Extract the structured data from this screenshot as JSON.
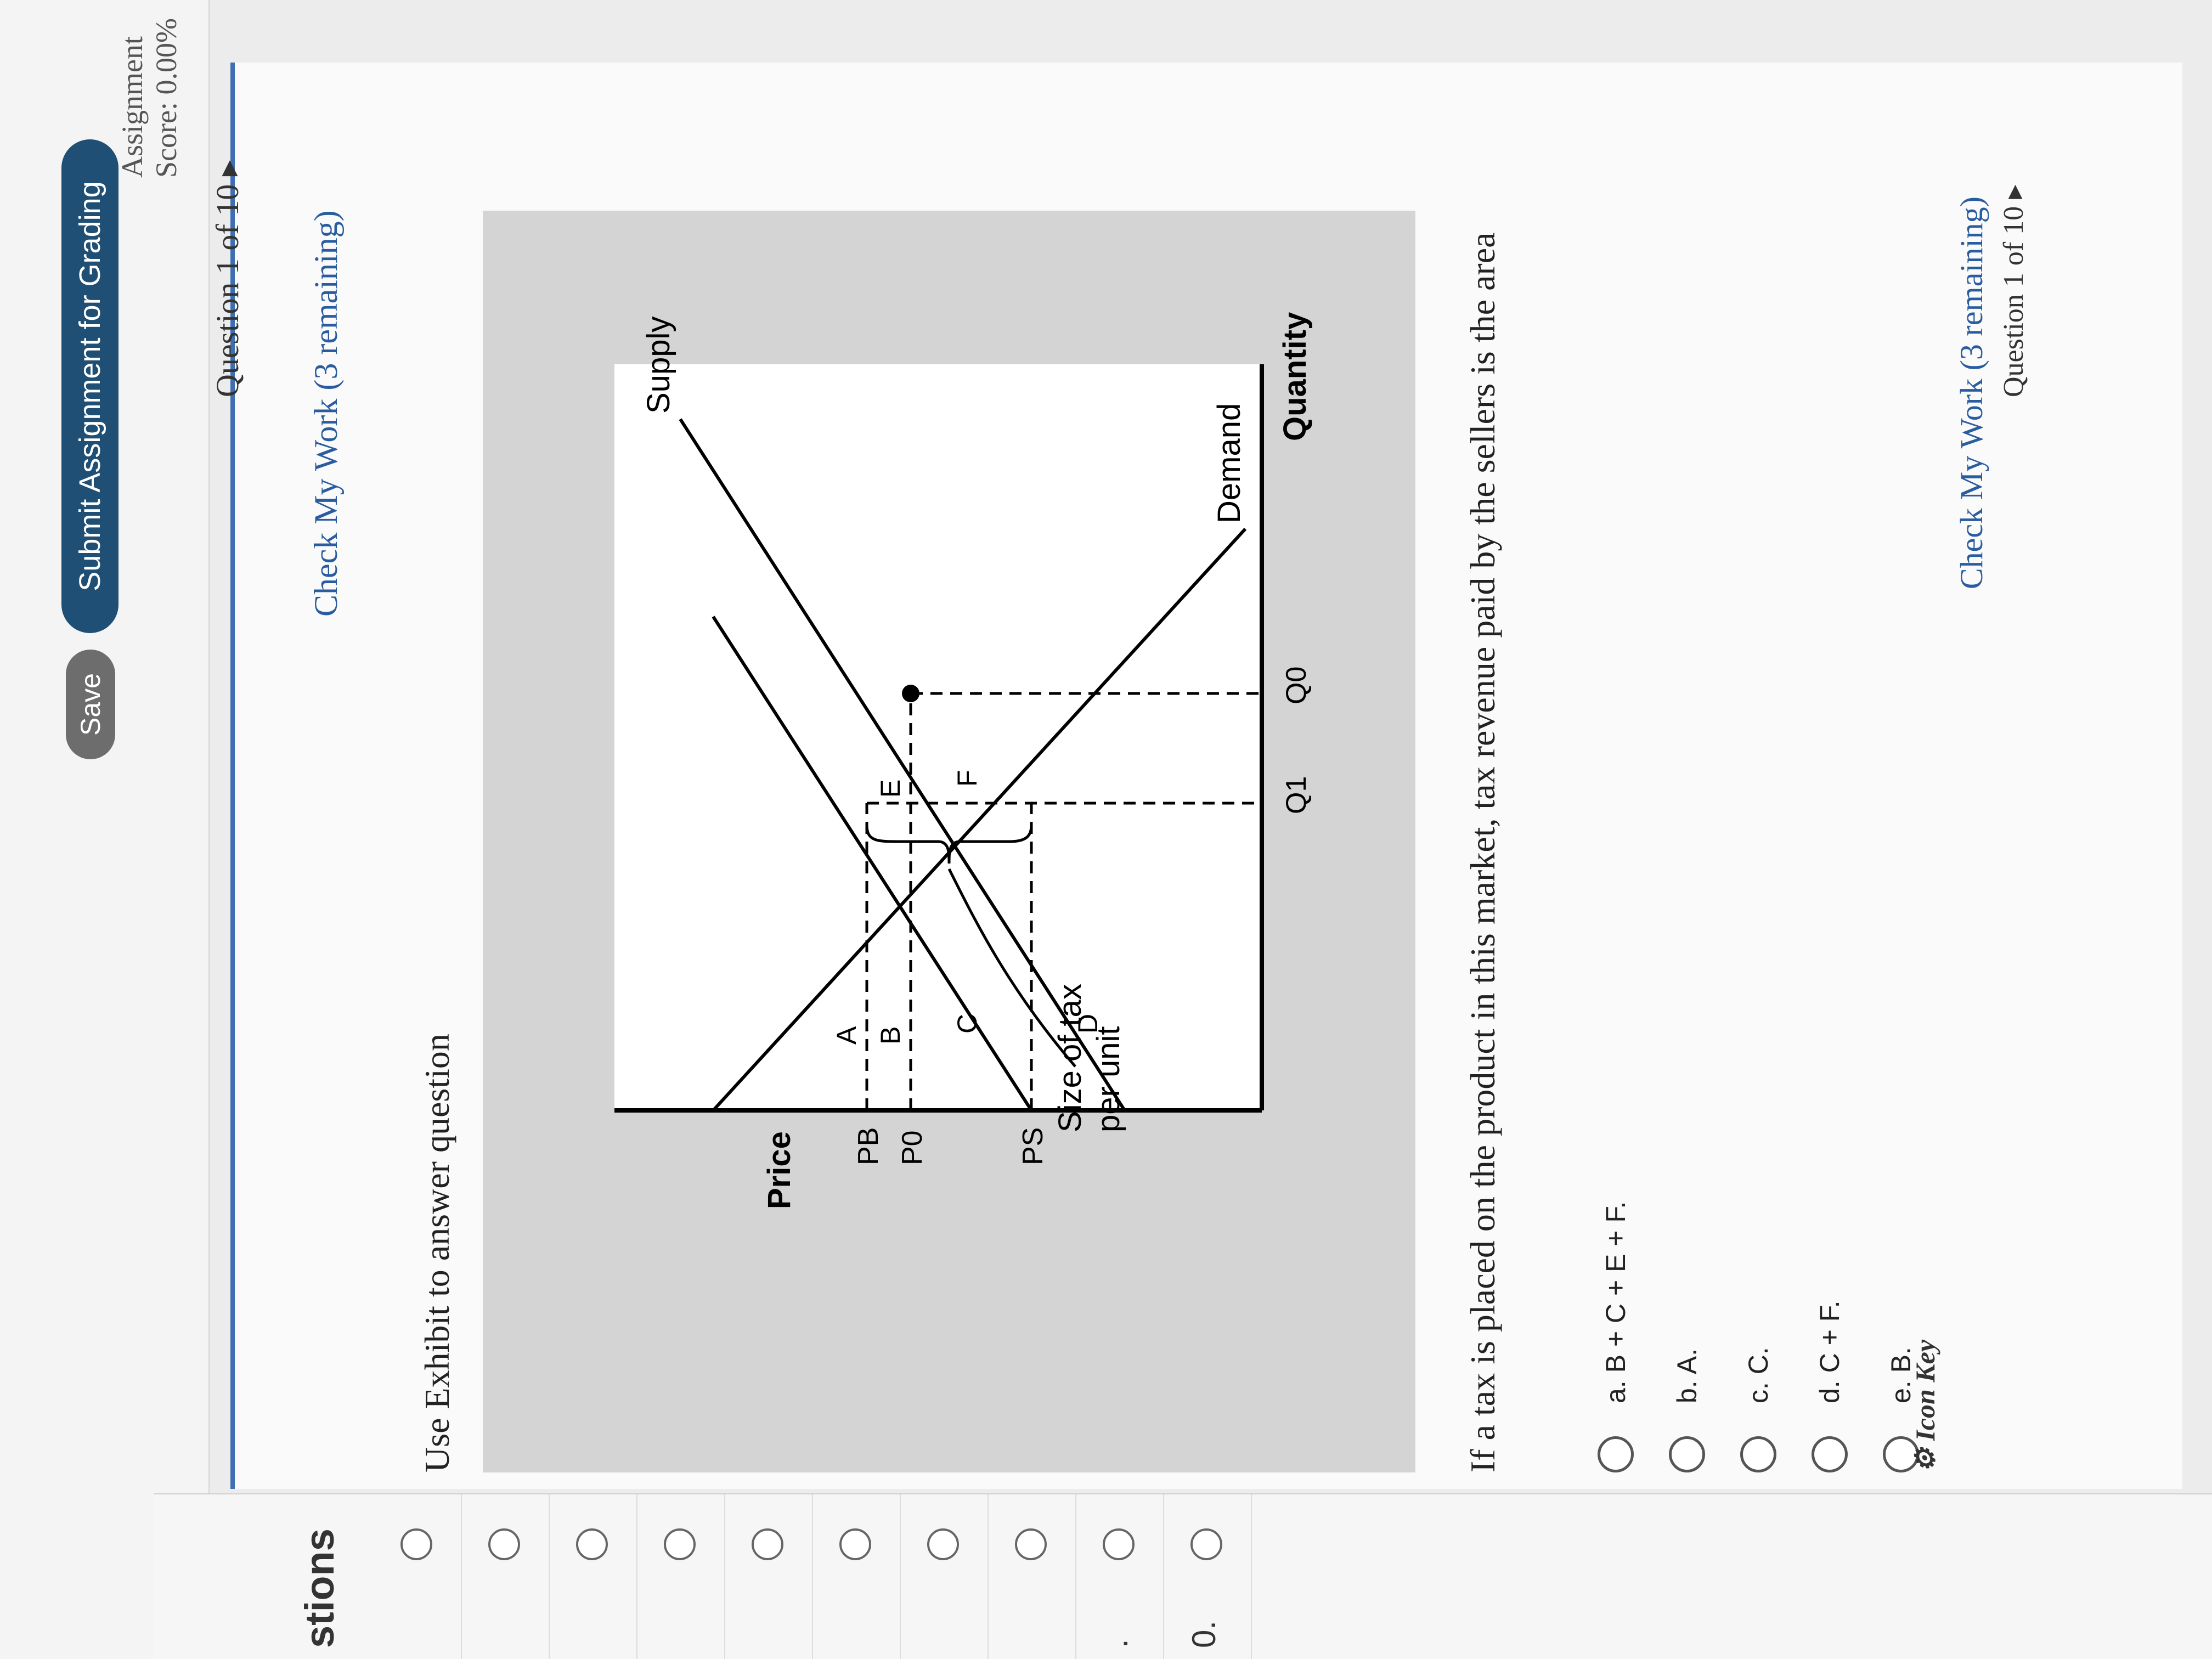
{
  "header": {
    "score_text": "Assignment Score: 0.00%",
    "save_label": "Save",
    "submit_label": "Submit Assignment for Grading"
  },
  "sidebar": {
    "title": "stions",
    "rows": [
      {
        "num": ""
      },
      {
        "num": ""
      },
      {
        "num": ""
      },
      {
        "num": ""
      },
      {
        "num": ""
      },
      {
        "num": ""
      },
      {
        "num": ""
      },
      {
        "num": ""
      },
      {
        "num": "."
      },
      {
        "num": "0."
      }
    ]
  },
  "nav": {
    "question_label": "Question 1 of 10",
    "check_label": "Check My Work (3 remaining)"
  },
  "content": {
    "instruction": "Use Exhibit to answer question",
    "question_text": "If a tax is placed on the product in this market, tax revenue paid by the sellers is the area"
  },
  "exhibit": {
    "y_axis_label": "Price",
    "x_axis_label": "Quantity",
    "supply_label": "Supply",
    "demand_label": "Demand",
    "tax_label_1": "Size of tax",
    "tax_label_2": "per unit",
    "pb_label": "PB",
    "p0_label": "P0",
    "ps_label": "PS",
    "q1_label": "Q1",
    "q0_label": "Q0",
    "area_a": "A",
    "area_b": "B",
    "area_c": "C",
    "area_d": "D",
    "area_e": "E",
    "area_f": "F"
  },
  "options": [
    {
      "label": "a. B + C + E + F."
    },
    {
      "label": "b. A."
    },
    {
      "label": "c. C."
    },
    {
      "label": "d. C + F."
    },
    {
      "label": "e. B."
    }
  ],
  "footer": {
    "icon_key": "Icon Key",
    "question_label": "Question 1 of 10",
    "check_label": "Check My Work (3 remaining)"
  },
  "colors": {
    "accent": "#1f4f74",
    "link": "#2a5da0",
    "panel_border": "#3d6fb1"
  }
}
